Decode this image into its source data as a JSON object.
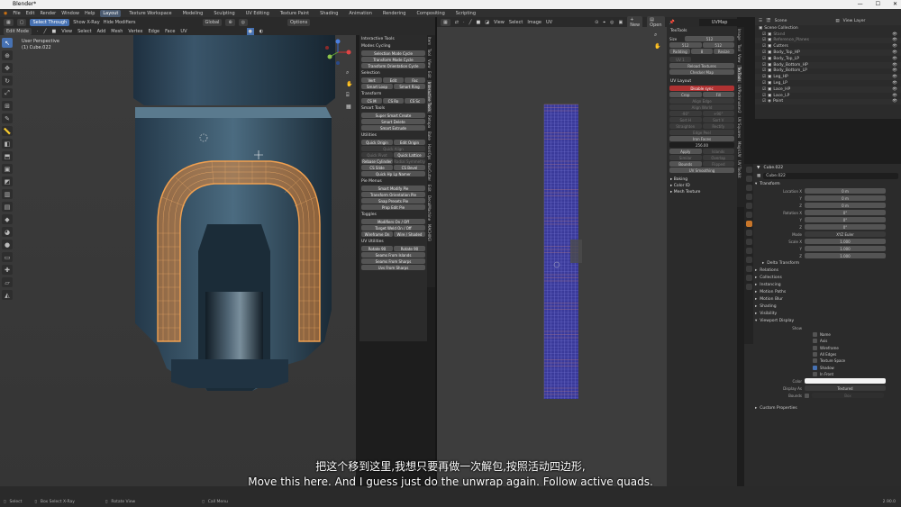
{
  "window": {
    "title": "Blender*"
  },
  "menu": {
    "items": [
      "File",
      "Edit",
      "Render",
      "Window",
      "Help"
    ],
    "workspaces": [
      "Layout",
      "Texture Workspace",
      "Modeling",
      "Sculpting",
      "UV Editing",
      "Texture Paint",
      "Shading",
      "Animation",
      "Rendering",
      "Compositing",
      "Scripting"
    ],
    "active_workspace": "Layout"
  },
  "viewport_header": {
    "select_through": "Select Through",
    "show_xray": "Show X-Ray",
    "hide_modifiers": "Hide Modifiers",
    "transform": "Global",
    "options": "Options",
    "mode": "Edit Mode",
    "menus": [
      "View",
      "Select",
      "Add",
      "Mesh",
      "Vertex",
      "Edge",
      "Face",
      "UV"
    ]
  },
  "viewport": {
    "view_name": "User Perspective",
    "object_name": "(1) Cube.022"
  },
  "interactive_tools": {
    "title": "Interactive Tools",
    "sections": [
      {
        "label": "Modes Cycling",
        "rows": [
          [
            "Selection Mode Cycle"
          ],
          [
            "Transform Mode Cycle"
          ],
          [
            "Transform Orientation Cycle"
          ]
        ]
      },
      {
        "label": "Selection",
        "rows": [
          [
            "Vert",
            "Edit",
            "Fac"
          ],
          [
            "Smart Loop",
            "Smart Ring"
          ]
        ]
      },
      {
        "label": "Transform",
        "rows": [
          [
            "CS M",
            "CS Ro",
            "CS Sc"
          ]
        ]
      },
      {
        "label": "Smart Tools",
        "rows": [
          [
            "Super Smart Create"
          ],
          [
            "Smart Delete"
          ],
          [
            "Smart Extrude"
          ]
        ]
      },
      {
        "label": "Utilities",
        "rows": [
          [
            "Quick Origin",
            "Edit Origin"
          ],
          [
            "Quick Align"
          ],
          [
            "Quick Pivot",
            "Quick Lattice"
          ],
          [
            "Rebase Cylinder",
            "Radial Symmetry"
          ],
          [
            "CS Slide",
            "CS Bevel"
          ],
          [
            "Quick Hp Lp Namer"
          ]
        ]
      },
      {
        "label": "Pie Menus",
        "rows": [
          [
            "Smart Modify Pie"
          ],
          [
            "Transform Orientation Pie"
          ],
          [
            "Snap Presets Pie"
          ],
          [
            "Prop Edit Pie"
          ]
        ]
      },
      {
        "label": "Toggles",
        "rows": [
          [
            "Modifiers On / Off"
          ],
          [
            "Target Weld On / Off"
          ],
          [
            "Wireframe On",
            "Wire / Shaded"
          ]
        ]
      },
      {
        "label": "UV Utilities",
        "rows": [
          [
            "Rotate 90",
            "Rotate 90"
          ],
          [
            "Seams From Islands"
          ],
          [
            "Seams From Sharps"
          ],
          [
            "Uvs From Sharps"
          ]
        ]
      }
    ]
  },
  "viewport_tabs": [
    "Item",
    "Tool",
    "View",
    "Edit",
    "Interactive Tools",
    "Retopo",
    "Bake",
    "HardOps",
    "BoxCutter",
    "Edit",
    "DecalMachine",
    "MACHIN3"
  ],
  "uv_header": {
    "menus": [
      "View",
      "Select",
      "Image",
      "UV"
    ],
    "new_label": "New",
    "open_label": "Open",
    "map_name": "UVMap"
  },
  "uv_side": {
    "toolbar_title": "TexTools",
    "size_label": "Size",
    "size_value": "512",
    "size_x": "512",
    "size_y": "512",
    "padding_label": "Padding",
    "padding_value": "8",
    "resize": "Resize",
    "uv_slot": "UV 1",
    "reload": "Reload Textures",
    "checker": "Checker Map",
    "layout_title": "UV Layout",
    "disable_sync": "Disable sync",
    "crop": "Crop",
    "fill": "Fill",
    "align_edge": "Align Edge",
    "align_world": "Align World",
    "rotate_a": "-90°",
    "rotate_b": "+90°",
    "sort_h": "Sort H",
    "sort_v": "Sort V",
    "straight": "Straighten",
    "rectify": "Rectify",
    "edge_peel": "Edge Peel",
    "iron_faces": "Iron Faces",
    "padding_num": "256.00",
    "apply": "Apply",
    "islands": "Islands",
    "select_similar": "Similar",
    "overlap": "Overlap",
    "bounds": "Bounds",
    "flipped": "Flipped",
    "uv_smoothing": "UV Smoothing",
    "panels": [
      "Baking",
      "Color ID",
      "Mesh Texture"
    ]
  },
  "uv_tabs": [
    "Image",
    "Tool",
    "View",
    "TexTools",
    "UVPackmaster2",
    "UV Squares",
    "MagicUV",
    "UV Toolkit"
  ],
  "outliner": {
    "header_scene": "Scene",
    "header_layer": "View Layer",
    "collection": "Scene Collection",
    "items": [
      "Stand",
      "Reference_Planes",
      "Cutters",
      "Body_Top_HP",
      "Body_Top_LP",
      "Body_Bottom_HP",
      "Body_Bottom_LP",
      "Leg_HP",
      "Leg_LP",
      "Lace_HP",
      "Lace_LP",
      "Point"
    ]
  },
  "properties": {
    "object": "Cube.022",
    "mesh": "Cube.022",
    "transform": "Transform",
    "location_label": "Location X",
    "loc": [
      "0 m",
      "0 m",
      "0 m"
    ],
    "rotation_label": "Rotation X",
    "rot": [
      "0°",
      "0°",
      "0°"
    ],
    "mode_label": "Mode",
    "mode": "XYZ Euler",
    "scale_label": "Scale X",
    "scale": [
      "1.000",
      "1.000",
      "1.000"
    ],
    "axis_labels": [
      "Y",
      "Z"
    ],
    "delta": "Delta Transform",
    "panels": [
      "Relations",
      "Collections",
      "Instancing",
      "Motion Paths",
      "Motion Blur",
      "Shading",
      "Visibility",
      "Viewport Display"
    ],
    "show_label": "Show",
    "show_items": [
      "Name",
      "Axis",
      "Wireframe",
      "All Edges",
      "Texture Space",
      "Shadow",
      "In Front"
    ],
    "color_label": "Color",
    "display_as_label": "Display As",
    "display_as": "Textured",
    "bounds_label": "Bounds",
    "bounds_value": "Box",
    "custom": "Custom Properties"
  },
  "status": {
    "select": "Select",
    "box_select": "Box Select X-Ray",
    "rotate": "Rotate View",
    "call_menu": "Call Menu",
    "version": "2.90.0"
  },
  "subtitles": {
    "zh": "把这个移到这里,我想只要再做一次解包,按照活动四边形,",
    "en": "Move this here. And I guess just do the unwrap again. Follow active quads."
  }
}
